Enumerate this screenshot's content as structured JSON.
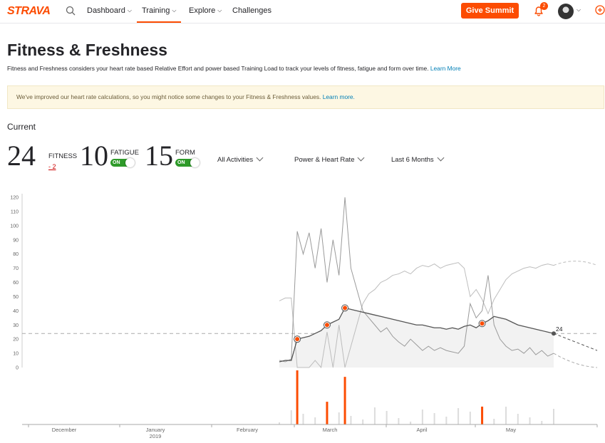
{
  "nav": {
    "logo": "STRAVA",
    "items": [
      {
        "label": "Dashboard",
        "chevron": true
      },
      {
        "label": "Training",
        "chevron": true,
        "active": true
      },
      {
        "label": "Explore",
        "chevron": true
      },
      {
        "label": "Challenges",
        "chevron": false
      }
    ],
    "give_summit": "Give Summit",
    "notifications_count": "2",
    "icons": [
      "search-icon",
      "bell-icon",
      "avatar",
      "plus-circle-icon"
    ]
  },
  "header": {
    "title": "Fitness & Freshness",
    "description": "Fitness and Freshness considers your heart rate based Relative Effort and power based Training Load to track your levels of fitness, fatigue and form over time.",
    "learn_more": "Learn More"
  },
  "notice": {
    "text": "We've improved our heart rate calculations, so you might notice some changes to your Fitness & Freshness values.",
    "link": "Learn more."
  },
  "current": {
    "label": "Current",
    "fitness": {
      "value": "24",
      "label": "FITNESS",
      "delta": "- 2"
    },
    "fatigue": {
      "value": "10",
      "label": "FATIGUE",
      "toggle": "ON"
    },
    "form": {
      "value": "15",
      "label": "FORM",
      "toggle": "ON"
    }
  },
  "filters": {
    "activities": "All Activities",
    "metric": "Power & Heart Rate",
    "range": "Last 6 Months"
  },
  "colors": {
    "accent": "#fc4c02",
    "toggle_on": "#2e9a29",
    "link": "#007fb6"
  },
  "chart_data": {
    "type": "line",
    "y_ticks": [
      "0",
      "10",
      "20",
      "30",
      "40",
      "50",
      "60",
      "70",
      "80",
      "90",
      "100",
      "110",
      "120"
    ],
    "ylim": [
      0,
      120
    ],
    "x_labels": [
      {
        "label": "December",
        "sub": ""
      },
      {
        "label": "January",
        "sub": "2019"
      },
      {
        "label": "February",
        "sub": ""
      },
      {
        "label": "March",
        "sub": ""
      },
      {
        "label": "April",
        "sub": ""
      },
      {
        "label": "May",
        "sub": ""
      }
    ],
    "current_value_label": "24",
    "reference_value": 24,
    "series": [
      {
        "name": "Fitness",
        "color": "#555555",
        "values": [
          4,
          5,
          5,
          20,
          21,
          22,
          24,
          26,
          30,
          32,
          34,
          42,
          41,
          40,
          39,
          38,
          37,
          36,
          35,
          34,
          33,
          32,
          31,
          30,
          30,
          29,
          28,
          28,
          27,
          28,
          27,
          29,
          30,
          28,
          31,
          33,
          36,
          35,
          34,
          32,
          30,
          29,
          28,
          27,
          26,
          25,
          24
        ]
      },
      {
        "name": "Fatigue",
        "color": "#9a9a9a",
        "values": [
          5,
          4,
          6,
          96,
          80,
          95,
          70,
          98,
          60,
          90,
          65,
          122,
          70,
          55,
          40,
          35,
          30,
          25,
          28,
          22,
          18,
          15,
          20,
          16,
          12,
          15,
          12,
          14,
          12,
          11,
          10,
          15,
          45,
          35,
          40,
          65,
          30,
          20,
          15,
          12,
          13,
          10,
          14,
          9,
          12,
          8,
          10
        ]
      },
      {
        "name": "Form",
        "color": "#bdbdbd",
        "values": [
          47,
          49,
          49,
          -20,
          -5,
          -30,
          5,
          -20,
          25,
          -10,
          30,
          -40,
          15,
          30,
          45,
          52,
          55,
          60,
          62,
          65,
          66,
          68,
          66,
          70,
          72,
          71,
          73,
          70,
          72,
          73,
          74,
          70,
          50,
          55,
          48,
          38,
          48,
          55,
          62,
          66,
          68,
          70,
          71,
          70,
          72,
          73,
          72
        ]
      },
      {
        "name": "Relative Effort",
        "color": "#fc4c02",
        "values": [
          0,
          0,
          0,
          0,
          0,
          0,
          0,
          0,
          0,
          0,
          0,
          0,
          0,
          0,
          0,
          0,
          0,
          0,
          0,
          0,
          0,
          0,
          0,
          0,
          0,
          0,
          0,
          0,
          0,
          0,
          0,
          0,
          0,
          0,
          0,
          0,
          0,
          0,
          0,
          0,
          0,
          0,
          0,
          0,
          0,
          0,
          0
        ]
      }
    ],
    "highlights": [
      {
        "series": "Fitness",
        "index": 3
      },
      {
        "series": "Fitness",
        "index": 8
      },
      {
        "series": "Fitness",
        "index": 11
      },
      {
        "series": "Fitness",
        "index": 34
      }
    ],
    "effort_bars": [
      {
        "date_index": 3,
        "value": 100,
        "highlight": true
      },
      {
        "date_index": 8,
        "value": 42,
        "highlight": true
      },
      {
        "date_index": 11,
        "value": 88,
        "highlight": true
      },
      {
        "date_index": 34,
        "value": 33,
        "highlight": true
      }
    ],
    "grid": false,
    "legend": "none"
  }
}
